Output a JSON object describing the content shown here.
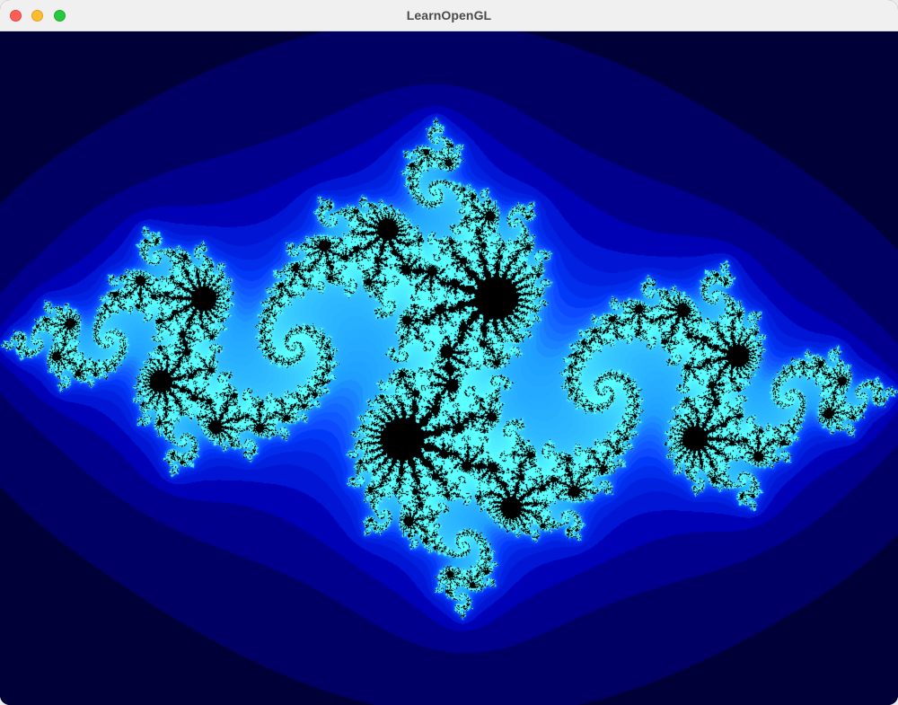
{
  "window": {
    "title": "LearnOpenGL"
  },
  "traffic_lights": {
    "close_color": "#ff5f57",
    "minimize_color": "#febc2e",
    "zoom_color": "#28c840"
  },
  "render": {
    "content": "julia-set-fractal",
    "colors": {
      "background": "#000016",
      "set_interior": "#000000",
      "deep_blue": "#0000c8",
      "bright_blue": "#1e5aff",
      "cyan_edge": "#3ce6ff"
    }
  }
}
